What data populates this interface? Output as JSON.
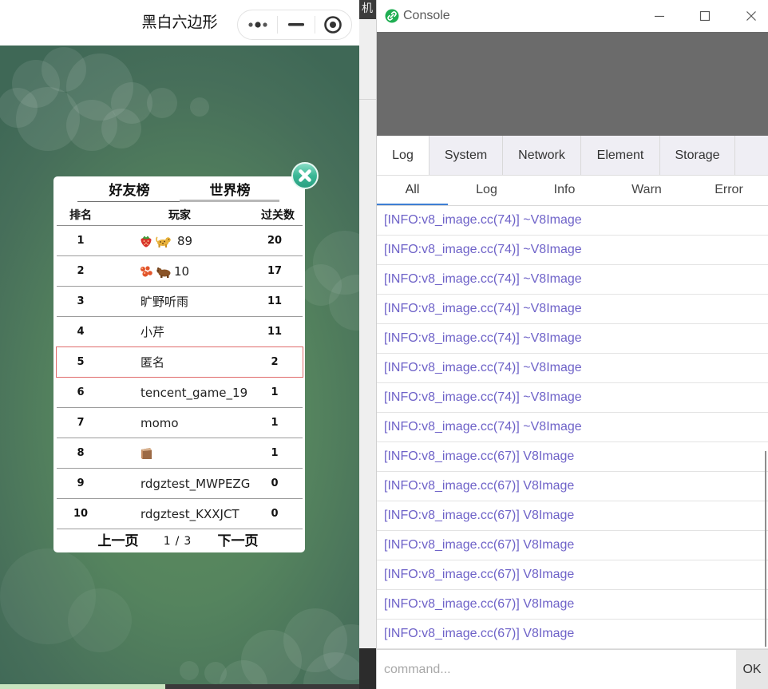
{
  "background_window": {
    "title_fragment": "机"
  },
  "game": {
    "title": "黑白六边形",
    "capsule": {
      "more_icon": "more-dots-icon",
      "minimize_icon": "minimize-icon",
      "exit_icon": "exit-target-icon"
    },
    "leaderboard": {
      "close_icon": "close-icon",
      "tabs": [
        {
          "label": "好友榜",
          "selected": false
        },
        {
          "label": "世界榜",
          "selected": true
        }
      ],
      "headers": {
        "rank": "排名",
        "player": "玩家",
        "score": "过关数"
      },
      "rows": [
        {
          "rank": "1",
          "icons": [
            "strawberry-icon",
            "leopard-icon"
          ],
          "name": "89",
          "score": "20"
        },
        {
          "rank": "2",
          "icons": [
            "berries-icon",
            "bear-icon"
          ],
          "name": "10",
          "score": "17"
        },
        {
          "rank": "3",
          "icons": [],
          "name": "旷野听雨",
          "score": "11"
        },
        {
          "rank": "4",
          "icons": [],
          "name": "小芹",
          "score": "11"
        },
        {
          "rank": "5",
          "icons": [],
          "name": "匿名",
          "score": "2",
          "highlighted": true
        },
        {
          "rank": "6",
          "icons": [],
          "name": "tencent_game_19",
          "score": "1"
        },
        {
          "rank": "7",
          "icons": [],
          "name": "momo",
          "score": "1"
        },
        {
          "rank": "8",
          "icons": [
            "box-icon"
          ],
          "score": "1"
        },
        {
          "rank": "9",
          "icons": [],
          "name": "rdgztest_MWPEZG",
          "score": "0"
        },
        {
          "rank": "10",
          "icons": [],
          "name": "rdgztest_KXXJCT",
          "score": "0"
        }
      ],
      "pagination": {
        "prev": "上一页",
        "current": "1",
        "separator": "/",
        "total": "3",
        "next": "下一页"
      }
    }
  },
  "console": {
    "title": "Console",
    "app_icon": "link-icon",
    "window_controls": {
      "minimize_icon": "window-minimize-icon",
      "maximize_icon": "window-maximize-icon",
      "close_icon": "window-close-icon"
    },
    "tabs": [
      {
        "label": "Log",
        "selected": true
      },
      {
        "label": "System",
        "selected": false
      },
      {
        "label": "Network",
        "selected": false
      },
      {
        "label": "Element",
        "selected": false
      },
      {
        "label": "Storage",
        "selected": false
      }
    ],
    "filters": [
      {
        "label": "All",
        "selected": true
      },
      {
        "label": "Log",
        "selected": false
      },
      {
        "label": "Info",
        "selected": false
      },
      {
        "label": "Warn",
        "selected": false
      },
      {
        "label": "Error",
        "selected": false
      }
    ],
    "logs": [
      "[INFO:v8_image.cc(74)] ~V8Image",
      "[INFO:v8_image.cc(74)] ~V8Image",
      "[INFO:v8_image.cc(74)] ~V8Image",
      "[INFO:v8_image.cc(74)] ~V8Image",
      "[INFO:v8_image.cc(74)] ~V8Image",
      "[INFO:v8_image.cc(74)] ~V8Image",
      "[INFO:v8_image.cc(74)] ~V8Image",
      "[INFO:v8_image.cc(74)] ~V8Image",
      "[INFO:v8_image.cc(67)] V8Image",
      "[INFO:v8_image.cc(67)] V8Image",
      "[INFO:v8_image.cc(67)] V8Image",
      "[INFO:v8_image.cc(67)] V8Image",
      "[INFO:v8_image.cc(67)] V8Image",
      "[INFO:v8_image.cc(67)] V8Image",
      "[INFO:v8_image.cc(67)] V8Image"
    ],
    "command": {
      "placeholder": "command...",
      "ok_label": "OK"
    }
  },
  "colors": {
    "log_text": "#6e62c8",
    "filter_underline": "#3d7fd4",
    "current_row_border": "#e06b6b",
    "console_preview_panel": "#6b6b6b",
    "app_icon_green": "#1fae52",
    "close_button_teal": "#3ab795"
  }
}
